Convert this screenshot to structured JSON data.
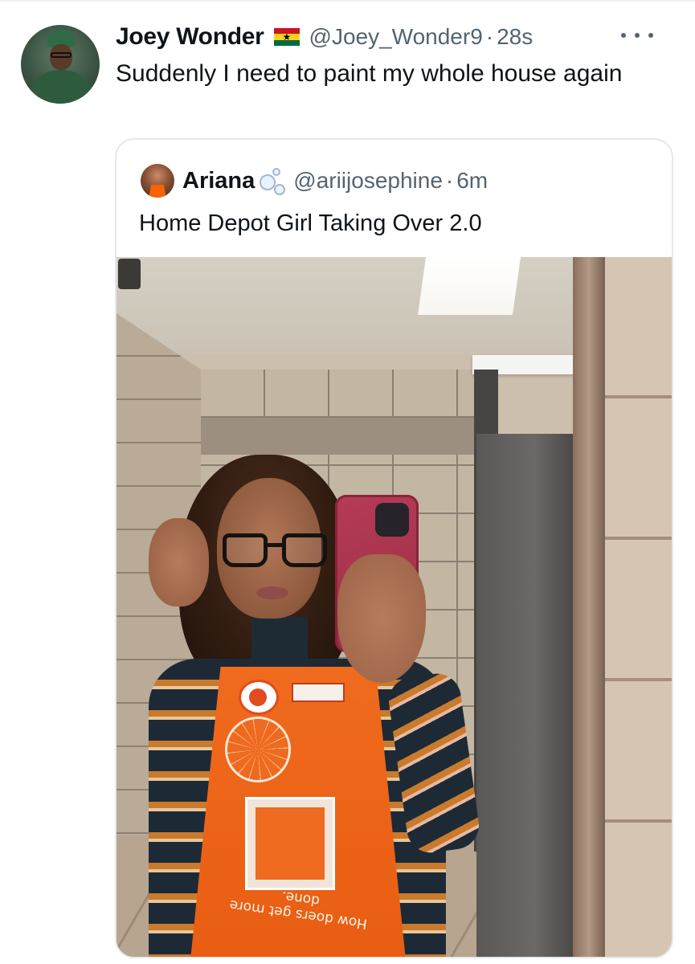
{
  "tweet": {
    "author": {
      "display_name": "Joey Wonder",
      "handle": "@Joey_Wonder9",
      "flag_icon": "ghana-flag-icon"
    },
    "separator": "·",
    "time": "28s",
    "text": "Suddenly I need to paint my whole house again",
    "more_icon": "ellipsis-icon"
  },
  "quoted_tweet": {
    "author": {
      "display_name": "Ariana",
      "handle": "@ariijosephine",
      "emoji_icon": "bubbles-icon"
    },
    "separator": "·",
    "time": "6m",
    "text": "Home Depot Girl Taking Over 2.0",
    "media": {
      "kind": "photo",
      "apron_slogan": "How doers get more done."
    }
  },
  "colors": {
    "text_primary": "#0f1419",
    "text_secondary": "#536471",
    "border": "#e4e9ec",
    "apron_orange": "#f06b1e"
  }
}
